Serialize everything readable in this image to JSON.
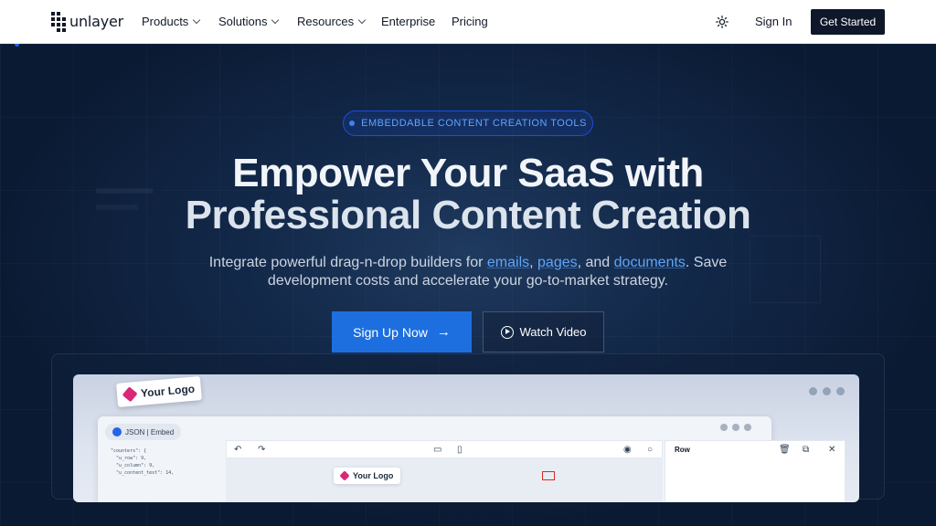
{
  "nav": {
    "brand": "unlayer",
    "items": [
      {
        "label": "Products",
        "dropdown": true
      },
      {
        "label": "Solutions",
        "dropdown": true
      },
      {
        "label": "Resources",
        "dropdown": true
      },
      {
        "label": "Enterprise",
        "dropdown": false
      },
      {
        "label": "Pricing",
        "dropdown": false
      }
    ],
    "theme_icon": "sun-icon",
    "sign_in": "Sign In",
    "get_started": "Get Started"
  },
  "hero": {
    "badge": "EMBEDDABLE CONTENT CREATION TOOLS",
    "title_line1": "Empower Your SaaS with",
    "title_line2": "Professional Content Creation",
    "sub_pre": "Integrate powerful drag-n-drop builders for ",
    "sub_link1": "emails",
    "sub_comma": ", ",
    "sub_link2": "pages",
    "sub_and": ", and ",
    "sub_link3": "documents",
    "sub_post": ". Save",
    "sub_line2": "development costs and accelerate your go-to-market strategy.",
    "primary_cta": "Sign Up Now",
    "primary_arrow": "→",
    "secondary_cta": "Watch Video"
  },
  "preview": {
    "logo_tag": "Your Logo",
    "json_pill": "JSON | Embed",
    "code": "\"counters\": {\n  \"u_row\": 9,\n  \"u_column\": 9,\n  \"u_content_text\": 14,",
    "mini_logo": "Your Logo",
    "panel_title": "Row"
  },
  "colors": {
    "accent": "#1d6fe0",
    "link": "#60a5fa",
    "hero_bg": "#0b1a33",
    "nav_cta_bg": "#0f172a"
  }
}
